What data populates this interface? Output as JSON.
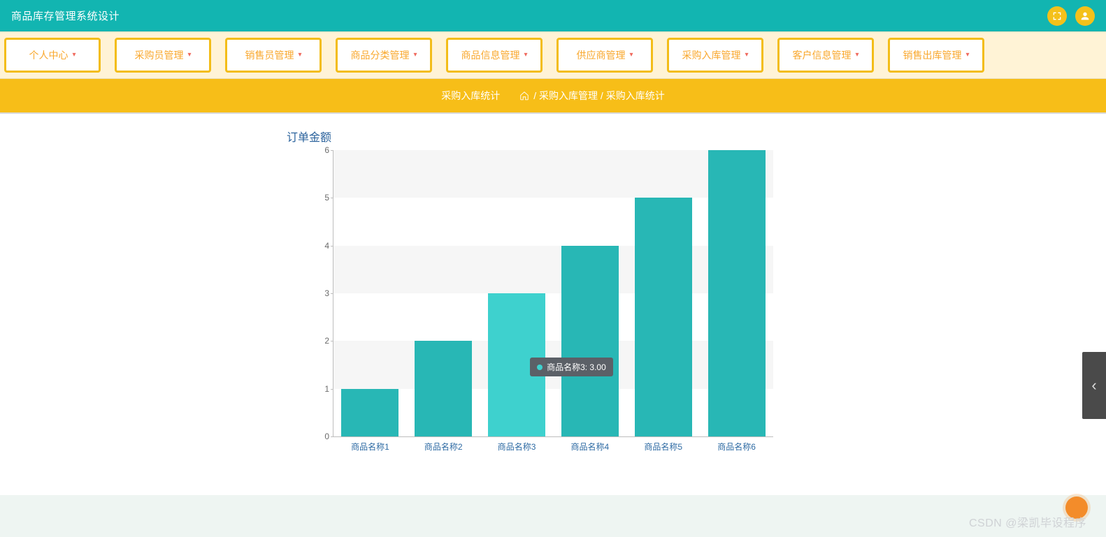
{
  "header": {
    "title": "商品库存管理系统设计"
  },
  "nav": {
    "items": [
      {
        "label": "个人中心"
      },
      {
        "label": "采购员管理"
      },
      {
        "label": "销售员管理"
      },
      {
        "label": "商品分类管理"
      },
      {
        "label": "商品信息管理"
      },
      {
        "label": "供应商管理"
      },
      {
        "label": "采购入库管理"
      },
      {
        "label": "客户信息管理"
      },
      {
        "label": "销售出库管理"
      }
    ]
  },
  "subheader": {
    "page_title": "采购入库统计",
    "crumb_text": "/ 采购入库管理 / 采购入库统计"
  },
  "chart_data": {
    "type": "bar",
    "title": "订单金额",
    "categories": [
      "商品名称1",
      "商品名称2",
      "商品名称3",
      "商品名称4",
      "商品名称5",
      "商品名称6"
    ],
    "values": [
      1,
      2,
      3,
      4,
      5,
      6
    ],
    "ylabel": "",
    "xlabel": "",
    "ylim": [
      0,
      6
    ],
    "yticks": [
      0,
      1,
      2,
      3,
      4,
      5,
      6
    ],
    "hover_index": 2,
    "tooltip_text": "商品名称3: 3.00"
  },
  "watermark": {
    "text": "CSDN @梁凯毕设程序"
  }
}
